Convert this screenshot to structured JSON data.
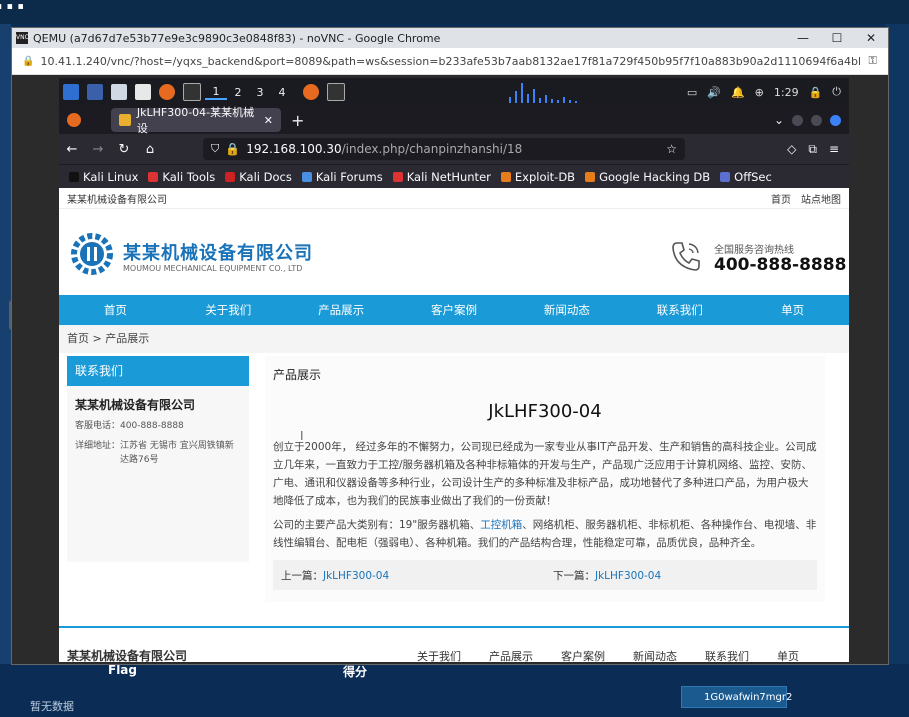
{
  "desktop": {
    "banner_text": "...",
    "bottom": {
      "flag": "Flag",
      "score": "得分",
      "no_data": "暂无数据",
      "id_tag": "1G0wafwin7mgr2"
    }
  },
  "chrome": {
    "title": "QEMU (a7d67d7e53b77e9e3c9890c3e0848f83) - noVNC - Google Chrome",
    "url": "10.41.1.240/vnc/?host=/yqxs_backend&port=8089&path=ws&session=b233afe53b7aab8132ae17f81a729f450b95f7f10a883b90a2d1110694f6a4bb&autoconn..."
  },
  "kali_panel": {
    "workspaces": [
      "1",
      "2",
      "3",
      "4"
    ],
    "time": "1:29"
  },
  "firefox": {
    "tab_title": "JkLHF300-04-某某机械设",
    "url_host": "192.168.100.30",
    "url_path": "/index.php/chanpinzhanshi/18",
    "bookmarks": [
      "Kali Linux",
      "Kali Tools",
      "Kali Docs",
      "Kali Forums",
      "Kali NetHunter",
      "Exploit-DB",
      "Google Hacking DB",
      "OffSec"
    ]
  },
  "site": {
    "topbar": {
      "company": "某某机械设备有限公司",
      "links": [
        "首页",
        "站点地图"
      ]
    },
    "brand": "某某机械设备有限公司",
    "brand_en": "MOUMOU MECHANICAL EQUIPMENT CO., LTD",
    "hotline_label": "全国服务咨询热线",
    "hotline": "400-888-8888",
    "nav": [
      "首页",
      "关于我们",
      "产品展示",
      "客户案例",
      "新闻动态",
      "联系我们",
      "单页"
    ],
    "breadcrumb": "首页 > 产品展示",
    "sidebar": {
      "title": "联系我们",
      "company": "某某机械设备有限公司",
      "phone_label": "客服电话：",
      "phone": "400-888-8888",
      "address_label": "详细地址：",
      "address": "江苏省 无锡市 宜兴周铁镇新达路76号"
    },
    "content": {
      "section": "产品展示",
      "title": "JkLHF300-04",
      "para1": "创立于2000年， 经过多年的不懈努力，公司现已经成为一家专业从事IT产品开发、生产和销售的高科技企业。公司成立几年来，一直致力于工控/服务器机箱及各种非标箱体的开发与生产，产品现广泛应用于计算机网络、监控、安防、广电、通讯和仪器设备等多种行业，公司设计生产的多种标准及非标产品，成功地替代了多种进口产品，为用户极大地降低了成本，也为我们的民族事业做出了我们的一份贡献！",
      "para2_a": "公司的主要产品大类别有：19\"服务器机箱、",
      "para2_link": "工控机箱",
      "para2_b": "、网络机柜、服务器机柜、非标机柜、各种操作台、电视墙、非线性编辑台、配电柜（强弱电）、各种机箱。我们的产品结构合理，性能稳定可靠，品质优良，品种齐全。",
      "prev_label": "上一篇：",
      "prev": "JkLHF300-04",
      "next_label": "下一篇：",
      "next": "JkLHF300-04"
    },
    "footer": {
      "company": "某某机械设备有限公司",
      "links": [
        "关于我们",
        "产品展示",
        "客户案例",
        "新闻动态",
        "联系我们",
        "单页"
      ]
    }
  }
}
